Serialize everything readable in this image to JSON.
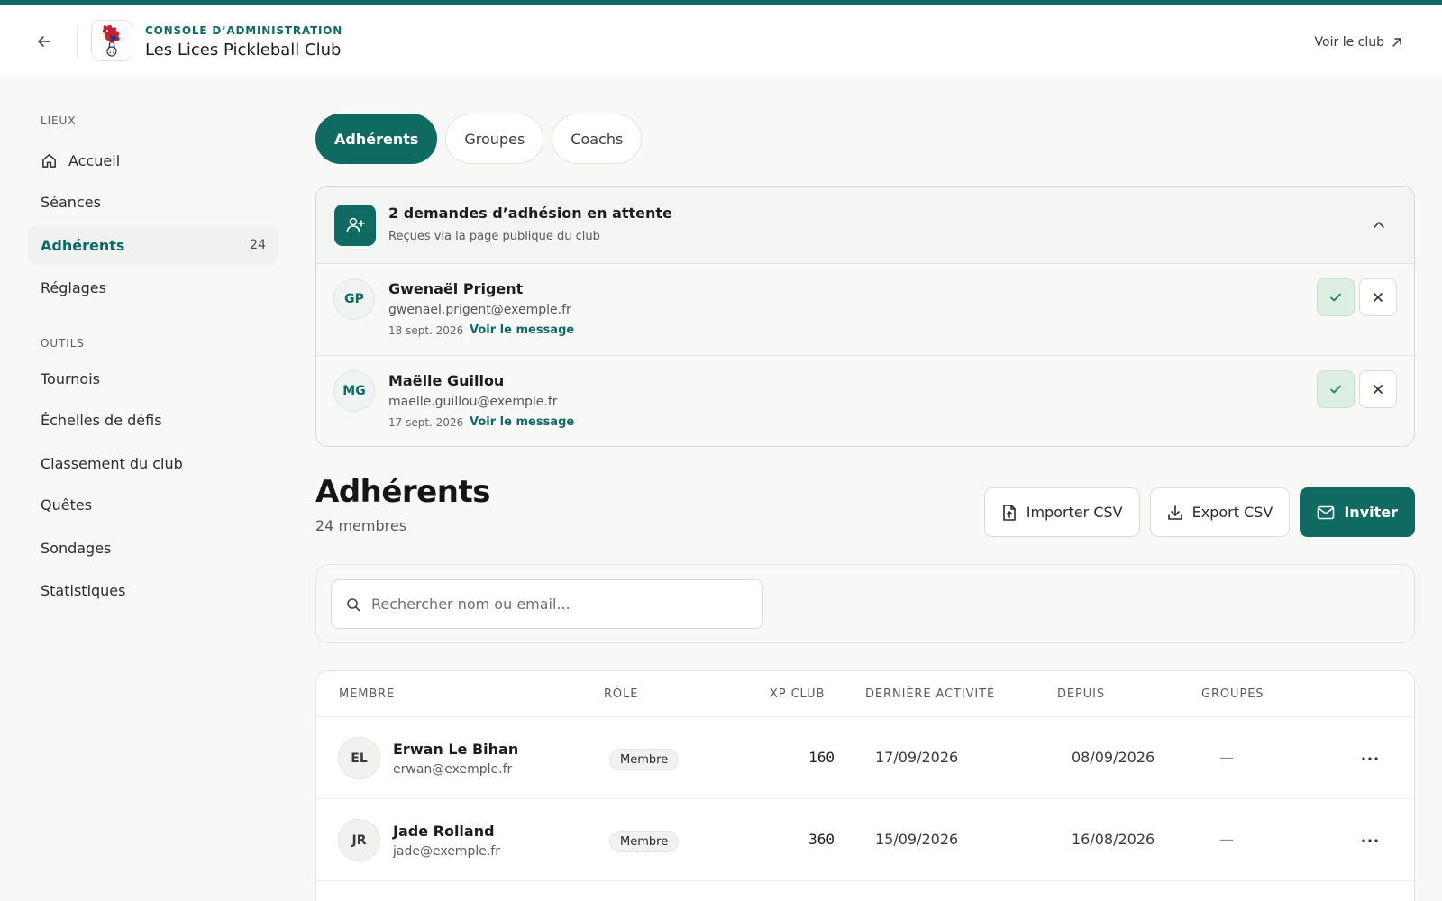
{
  "header": {
    "eyebrow": "CONSOLE D’ADMINISTRATION",
    "club_name": "Les Lices Pickleball Club",
    "view_club": "Voir le club"
  },
  "sidebar": {
    "sections": [
      {
        "label": "LIEUX"
      },
      {
        "label": "OUTILS"
      }
    ],
    "items": [
      {
        "label": "Accueil",
        "icon": "home-icon"
      },
      {
        "label": "Séances"
      },
      {
        "label": "Adhérents",
        "count": "24",
        "active": true
      },
      {
        "label": "Réglages"
      },
      {
        "label": "Tournois"
      },
      {
        "label": "Échelles de défis"
      },
      {
        "label": "Classement du club"
      },
      {
        "label": "Quêtes"
      },
      {
        "label": "Sondages"
      },
      {
        "label": "Statistiques"
      }
    ]
  },
  "tabs": [
    {
      "label": "Adhérents",
      "active": true
    },
    {
      "label": "Groupes"
    },
    {
      "label": "Coachs"
    }
  ],
  "pending": {
    "title": "2 demandes d’adhésion en attente",
    "subtitle": "Reçues via la page publique du club",
    "requests": [
      {
        "initials": "GP",
        "name": "Gwenaël Prigent",
        "email": "gwenael.prigent@exemple.fr",
        "date": "18 sept. 2026",
        "link": "Voir le message"
      },
      {
        "initials": "MG",
        "name": "Maëlle Guillou",
        "email": "maelle.guillou@exemple.fr",
        "date": "17 sept. 2026",
        "link": "Voir le message"
      }
    ]
  },
  "members": {
    "title": "Adhérents",
    "count_label": "24 membres",
    "actions": {
      "import": "Importer CSV",
      "export": "Export CSV",
      "invite": "Inviter"
    },
    "search_placeholder": "Rechercher nom ou email...",
    "columns": {
      "member": "MEMBRE",
      "role": "RÔLE",
      "xp": "XP CLUB",
      "last_activity": "DERNIÈRE ACTIVITÉ",
      "since": "DEPUIS",
      "groups": "GROUPES"
    },
    "rows": [
      {
        "initials": "EL",
        "name": "Erwan Le Bihan",
        "email": "erwan@exemple.fr",
        "role": "Membre",
        "xp": "160",
        "last": "17/09/2026",
        "since": "08/09/2026",
        "groups": "—"
      },
      {
        "initials": "JR",
        "name": "Jade Rolland",
        "email": "jade@exemple.fr",
        "role": "Membre",
        "xp": "360",
        "last": "15/09/2026",
        "since": "16/08/2026",
        "groups": "—"
      }
    ]
  },
  "colors": {
    "accent": "#0f6b62",
    "accept_bg": "#ddeee3",
    "page_bg": "#f8f8f6"
  }
}
